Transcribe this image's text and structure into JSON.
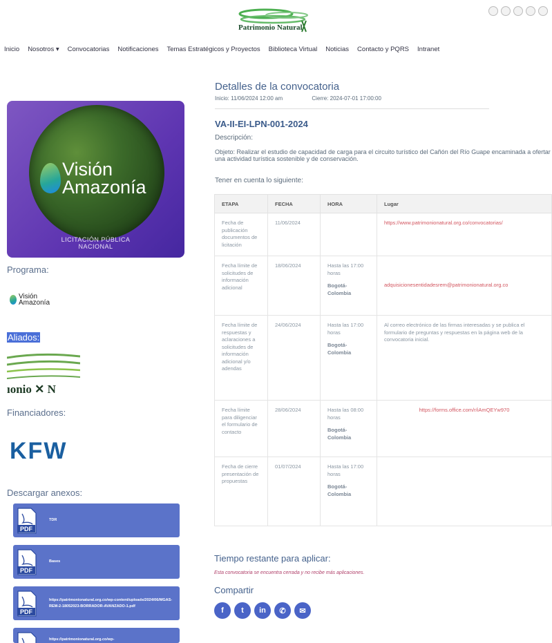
{
  "header": {
    "logo_text": "Patrimonio Natural",
    "social_icons": [
      "email-icon",
      "instagram-icon",
      "twitter-icon",
      "facebook-icon",
      "youtube-icon"
    ]
  },
  "nav": [
    "Inicio",
    "Nosotros ▾",
    "Convocatorias",
    "Notificaciones",
    "Temas Estratégicos y Proyectos",
    "Biblioteca Virtual",
    "Noticias",
    "Contacto y PQRS",
    "Intranet"
  ],
  "sidebar": {
    "poster": {
      "title_line1": "Visión",
      "title_line2": "Amazonía",
      "subtitle_line1": "LICITACIÓN PÚBLICA",
      "subtitle_line2": "NACIONAL"
    },
    "programa_label": "Programa:",
    "programa_logo_line1": "Visión",
    "programa_logo_line2": "Amazonía",
    "aliados_label": "Aliados:",
    "aliados_logo_text": "ıonio  ✕  N",
    "financiadores_label": "Financiadores:",
    "kfw": "KFW",
    "descargar_label": "Descargar anexos:",
    "annexes": [
      "TDR",
      "Bases",
      "https://patrimonionatural.org.co/wp-content/uploads/2024/06/MGAS-REM-2-18052023-BORRADOR-AVANZADO-1.pdf",
      "https://patrimonionatural.org.co/wp-"
    ]
  },
  "main": {
    "title": "Detalles de la convocatoria",
    "inicio": "Inicio: 11/06/2024 12:00 am",
    "cierre": "Cierre: 2024-07-01 17:00:00",
    "code": "VA-II-EI-LPN-001-2024",
    "descripcion_label": "Descripción:",
    "descripcion": "Objeto: Realizar el estudio de capacidad de carga para el circuito turístico del Cañón del Río Guape encaminada a ofertar una actividad turística sostenible y de conservación.",
    "tener_label": "Tener en cuenta lo siguiente:",
    "table": {
      "headers": [
        "ETAPA",
        "FECHA",
        "HORA",
        "Lugar"
      ],
      "rows": [
        {
          "etapa": "Fecha de publicación documentos de licitación",
          "fecha": "11/06/2024",
          "hora": "",
          "ciudad": "",
          "lugar": "https://www.patrimonionatural.org.co/convocatorias/"
        },
        {
          "etapa": "Fecha límite de solicitudes de información adicional",
          "fecha": "18/06/2024",
          "hora": "Hasta las 17:00 horas",
          "ciudad": "Bogotá-Colombia",
          "lugar": "adquisicionesentidadesrem@patrimonionatural.org.co"
        },
        {
          "etapa": "Fecha límite de respuestas y aclaraciones a solicitudes de información adicional y/o adendas",
          "fecha": "24/06/2024",
          "hora": "Hasta las 17:00 horas",
          "ciudad": "Bogotá-Colombia",
          "lugar": "Al correo electrónico de las firmas interesadas y se publica el formulario de preguntas y respuestas en la página web de la convocatoria inicial."
        },
        {
          "etapa": "Fecha límite para diligenciar el formulario de contacto",
          "fecha": "28/06/2024",
          "hora": "Hasta las 08:00 horas",
          "ciudad": "Bogotá-Colombia",
          "lugar": "https://forms.office.com/r/iAmQEYw970"
        },
        {
          "etapa": "Fecha de cierre presentación de propuestas",
          "fecha": "01/07/2024",
          "hora": "Hasta las 17:00 horas",
          "ciudad": "Bogotá-Colombia",
          "lugar": ""
        }
      ]
    },
    "tiempo_label": "Tiempo restante para aplicar:",
    "cerrada_msg": "Esta convocatoria se encuentra cerrada y no recibe más aplicaciones.",
    "compartir_label": "Compartir",
    "share_icons": [
      "facebook-icon",
      "twitter-icon",
      "linkedin-icon",
      "whatsapp-icon",
      "email-icon"
    ]
  },
  "colors": {
    "accent": "#4a64c7",
    "annex_button": "#5b73c9",
    "heading": "#44618c",
    "link": "#d2555f",
    "poster_purple": "#5e35b1"
  }
}
